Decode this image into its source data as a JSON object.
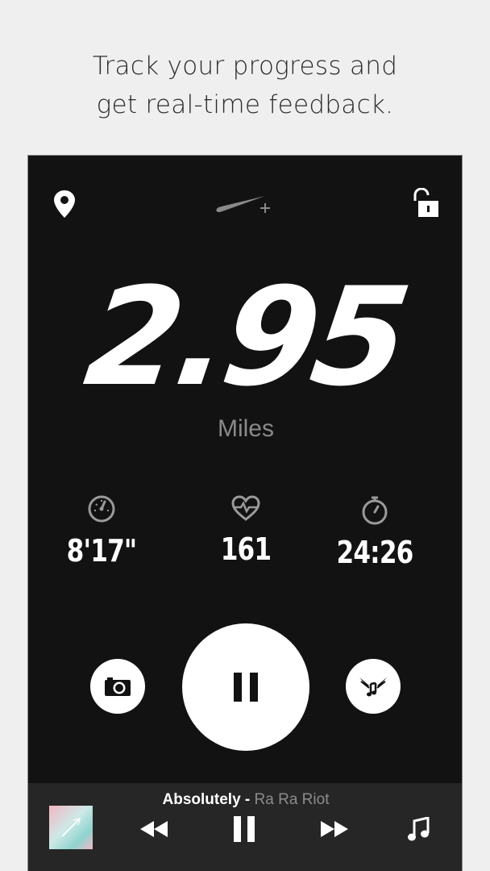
{
  "promo": {
    "line1": "Track your progress and",
    "line2": "get real-time feedback."
  },
  "header": {
    "left_icon": "location-pin-icon",
    "logo": "nike-plus-logo",
    "right_icon": "unlock-icon"
  },
  "run": {
    "distance": "2.95",
    "distance_unit": "Miles",
    "stats": [
      {
        "icon": "speedometer-icon",
        "value": "8'17\""
      },
      {
        "icon": "heart-rate-icon",
        "value": "161"
      },
      {
        "icon": "stopwatch-icon",
        "value": "24:26"
      }
    ]
  },
  "controls": {
    "camera_icon": "camera-icon",
    "pause_icon": "pause-icon",
    "powersong_icon": "winged-music-icon"
  },
  "player": {
    "song": "Absolutely",
    "separator": " - ",
    "artist": "Ra Ra Riot",
    "icons": [
      "album-art",
      "rewind-icon",
      "pause-icon",
      "fast-forward-icon",
      "music-note-icon"
    ]
  },
  "colors": {
    "background": "#efefef",
    "screen": "#121212",
    "player_bar": "#262626",
    "accent": "#ffffff",
    "muted": "#8a8a8a"
  }
}
